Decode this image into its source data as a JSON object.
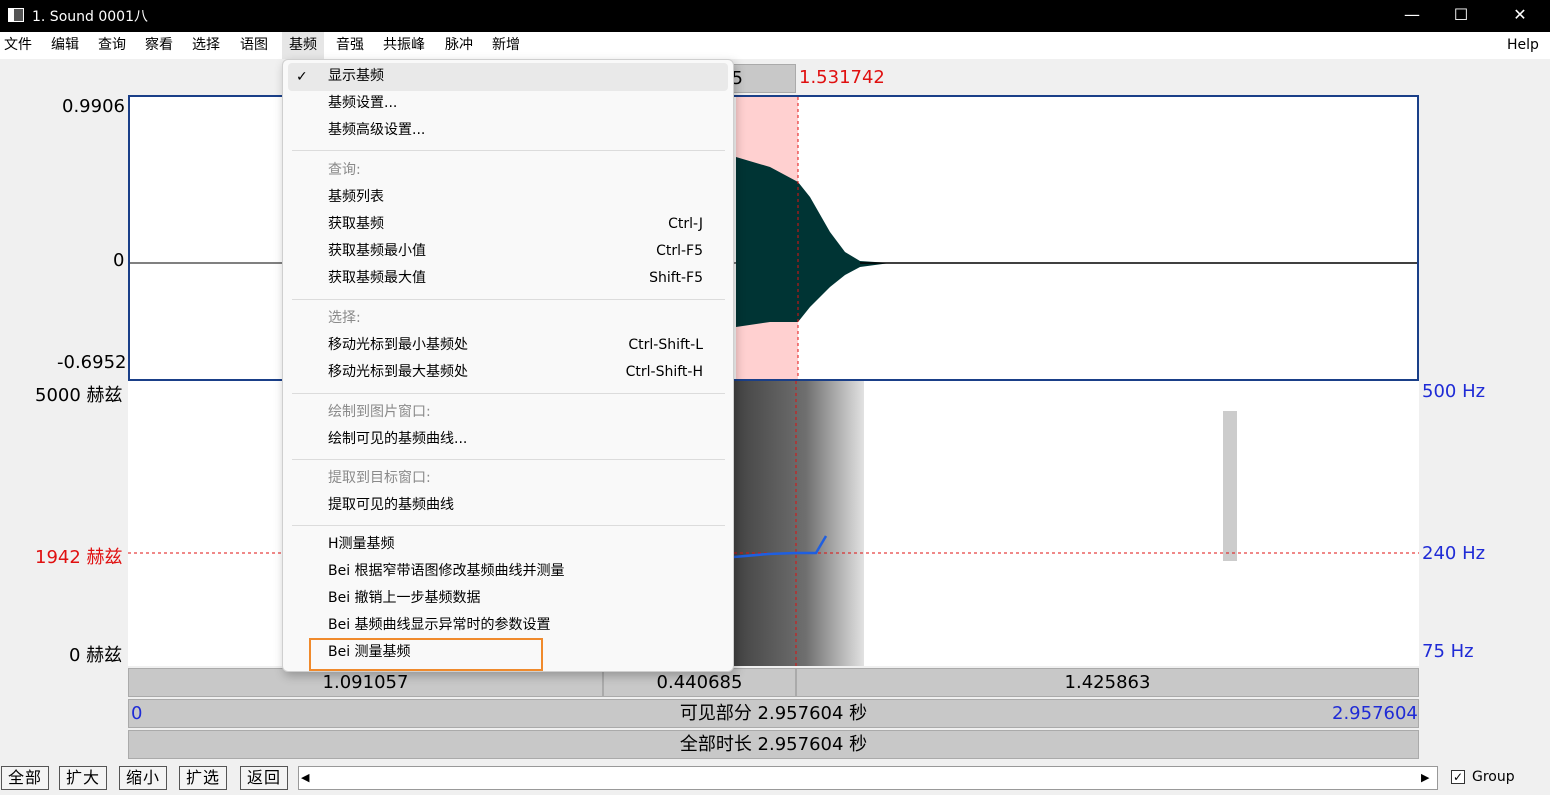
{
  "window": {
    "title": "1. Sound 0001八",
    "minimize": "—",
    "maximize": "☐",
    "close": "✕"
  },
  "menubar": {
    "items": [
      "文件",
      "编辑",
      "查询",
      "察看",
      "选择",
      "语图",
      "基频",
      "音强",
      "共振峰",
      "脉冲",
      "新增"
    ],
    "help": "Help"
  },
  "selection": {
    "top_partial": "5",
    "cursor_time": "1.531742"
  },
  "waveform": {
    "ymax": "0.9906",
    "yzero": "0",
    "ymin": "-0.6952"
  },
  "spectrogram": {
    "left_top": "5000 赫兹",
    "left_cursor": "1942 赫兹",
    "left_bottom": "0 赫兹",
    "right_top": "500 Hz",
    "right_cursor": "240 Hz",
    "right_bottom": "75 Hz"
  },
  "time_bars": {
    "seg_left": "1.091057",
    "seg_mid": "0.440685",
    "seg_right": "1.425863",
    "visible_start": "0",
    "visible_label": "可见部分 2.957604 秒",
    "visible_end": "2.957604",
    "total_label": "全部时长 2.957604 秒"
  },
  "bottom_buttons": [
    "全部",
    "扩大",
    "缩小",
    "扩选",
    "返回"
  ],
  "group": {
    "label": "Group",
    "checked": true
  },
  "dropdown": {
    "check": "✓",
    "items": [
      {
        "label": "显示基频",
        "shortcut": "",
        "type": "item"
      },
      {
        "label": "基频设置...",
        "shortcut": "",
        "type": "item"
      },
      {
        "label": "基频高级设置...",
        "shortcut": "",
        "type": "item"
      },
      {
        "label": "查询:",
        "shortcut": "",
        "type": "header"
      },
      {
        "label": "基频列表",
        "shortcut": "",
        "type": "item"
      },
      {
        "label": "获取基频",
        "shortcut": "Ctrl-J",
        "type": "item"
      },
      {
        "label": "获取基频最小值",
        "shortcut": "Ctrl-F5",
        "type": "item"
      },
      {
        "label": "获取基频最大值",
        "shortcut": "Shift-F5",
        "type": "item"
      },
      {
        "label": "选择:",
        "shortcut": "",
        "type": "header"
      },
      {
        "label": "移动光标到最小基频处",
        "shortcut": "Ctrl-Shift-L",
        "type": "item"
      },
      {
        "label": "移动光标到最大基频处",
        "shortcut": "Ctrl-Shift-H",
        "type": "item"
      },
      {
        "label": "绘制到图片窗口:",
        "shortcut": "",
        "type": "header"
      },
      {
        "label": "绘制可见的基频曲线...",
        "shortcut": "",
        "type": "item"
      },
      {
        "label": "提取到目标窗口:",
        "shortcut": "",
        "type": "header"
      },
      {
        "label": "提取可见的基频曲线",
        "shortcut": "",
        "type": "item"
      },
      {
        "label": "H测量基频",
        "shortcut": "",
        "type": "item"
      },
      {
        "label": "Bei 根据窄带语图修改基频曲线并测量",
        "shortcut": "",
        "type": "item"
      },
      {
        "label": "Bei 撤销上一步基频数据",
        "shortcut": "",
        "type": "item"
      },
      {
        "label": "Bei 基频曲线显示异常时的参数设置",
        "shortcut": "",
        "type": "item"
      },
      {
        "label": "Bei 测量基频",
        "shortcut": "",
        "type": "item"
      }
    ],
    "highlight_color": "#f08a2c"
  },
  "colors": {
    "selection": "#ffd0d0",
    "cursor": "#e01010",
    "pitch": "#1f5fe0",
    "wave": "#003434"
  }
}
